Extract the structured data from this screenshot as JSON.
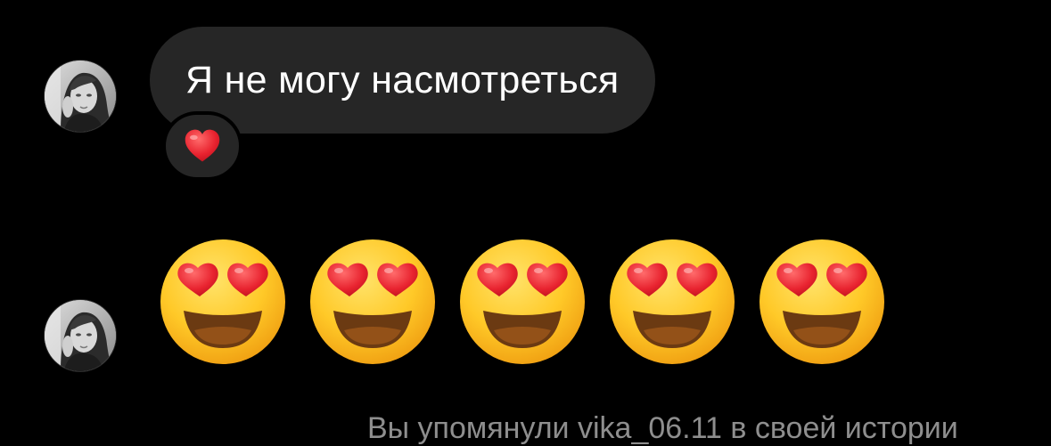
{
  "messages": [
    {
      "type": "text",
      "text": "Я не могу насмотреться",
      "reaction": "heart"
    },
    {
      "type": "emoji",
      "emojis": [
        "heart-eyes-face",
        "heart-eyes-face",
        "heart-eyes-face",
        "heart-eyes-face",
        "heart-eyes-face"
      ]
    }
  ],
  "footer": {
    "note": "Вы упомянули vika_06.11 в своей истории"
  },
  "colors": {
    "background": "#000000",
    "bubble": "#262626",
    "text": "#ffffff",
    "muted_text": "#8e8e8e",
    "heart": "#e8232f",
    "emoji_face": "#ffc928"
  },
  "icons": [
    "avatar",
    "heart-icon",
    "heart-eyes-face-icon"
  ]
}
